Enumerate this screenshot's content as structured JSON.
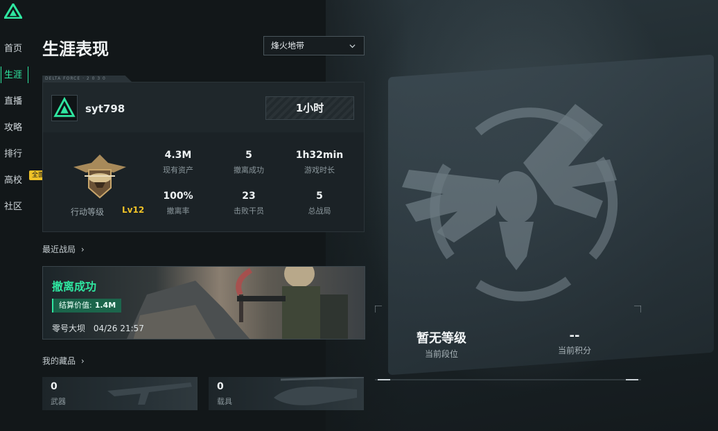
{
  "sidebar": {
    "items": [
      {
        "label": "首页"
      },
      {
        "label": "生涯",
        "active": true
      },
      {
        "label": "直播"
      },
      {
        "label": "攻略"
      },
      {
        "label": "排行"
      },
      {
        "label": "高校"
      },
      {
        "label": "社区"
      }
    ],
    "update_badge": "全面更新"
  },
  "header": {
    "title": "生涯表现",
    "mode_select": {
      "selected": "烽火地带",
      "icon": "chevron-down-icon"
    }
  },
  "profile": {
    "tab_text": "DELTA FORCE · 2 0 3 0",
    "username": "syt798",
    "playtime": "1小时",
    "rank": {
      "label": "行动等级",
      "level": "Lv12"
    },
    "stats": [
      {
        "value": "4.3M",
        "label": "现有资产"
      },
      {
        "value": "5",
        "label": "撤离成功"
      },
      {
        "value": "1h32min",
        "label": "游戏时长"
      },
      {
        "value": "100%",
        "label": "撤离率"
      },
      {
        "value": "23",
        "label": "击败干员"
      },
      {
        "value": "5",
        "label": "总战局"
      }
    ]
  },
  "recent": {
    "label": "最近战局",
    "battle": {
      "result": "撤离成功",
      "value_label": "结算价值:",
      "value": "1.4M",
      "map": "零号大坝",
      "time": "04/26 21:57"
    }
  },
  "collection": {
    "label": "我的藏品",
    "items": [
      {
        "value": "0",
        "label": "武器"
      },
      {
        "value": "0",
        "label": "载具"
      }
    ]
  },
  "hero": {
    "rank": {
      "value": "暂无等级",
      "label": "当前段位"
    },
    "score": {
      "value": "--",
      "label": "当前积分"
    }
  },
  "colors": {
    "accent": "#2fe6a0",
    "gold": "#f0c227",
    "background": "#121719"
  }
}
